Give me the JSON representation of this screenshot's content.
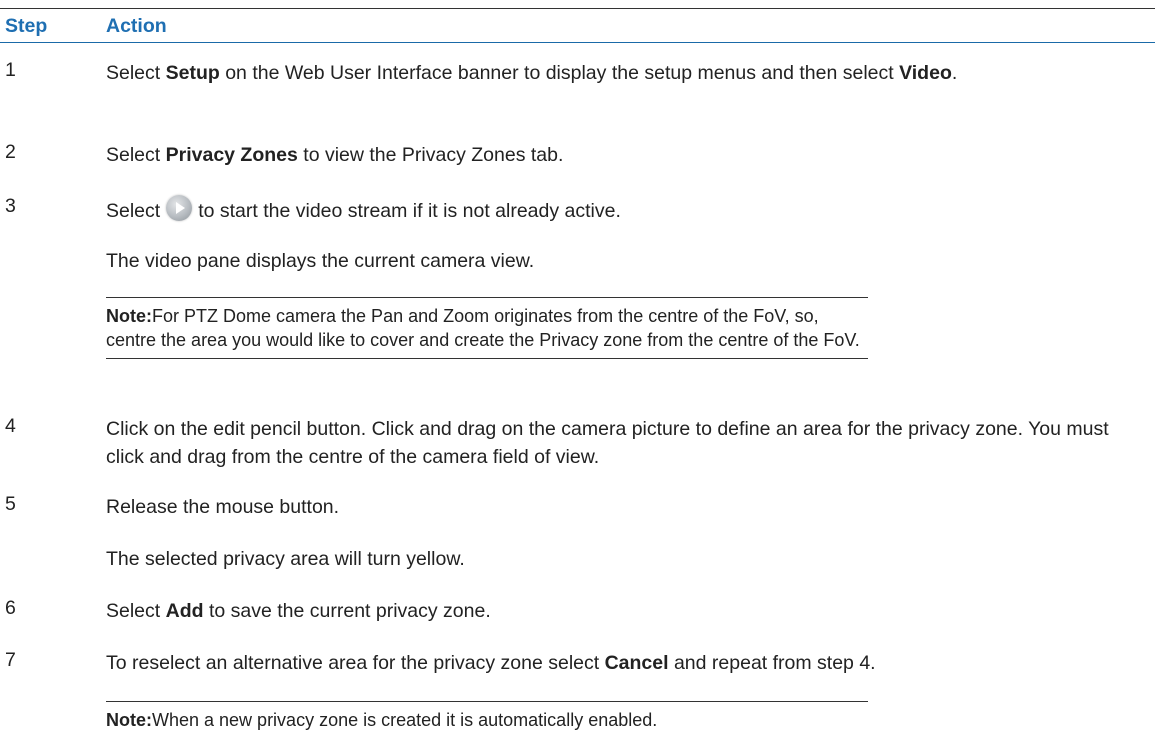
{
  "header": {
    "step": "Step",
    "action": "Action"
  },
  "steps": [
    {
      "number": "1",
      "t1": "Select ",
      "b1": "Setup",
      "t2": " on the Web User Interface banner to display the setup menus and then select ",
      "b2": "Video",
      "t3": "."
    },
    {
      "number": "2",
      "t1": "Select ",
      "b1": "Privacy Zones",
      "t2": " to view the Privacy Zones tab."
    },
    {
      "number": "3",
      "t1": "Select",
      "icon": "play-button-icon",
      "t2": "to start the video stream if it is not already active.",
      "result": "The video pane displays the current camera view.",
      "note_label": "Note:",
      "note_text": "For PTZ Dome camera the Pan and Zoom originates from the centre of the FoV, so, centre the area you would like to cover and create the Privacy zone from the centre of the FoV."
    },
    {
      "number": "4",
      "text": "Click on the edit pencil button. Click and drag on the camera picture to define an area for the privacy zone. You must click and drag from the centre of the camera field of view."
    },
    {
      "number": "5",
      "text": "Release the mouse button.",
      "result": "The selected privacy area will turn yellow."
    },
    {
      "number": "6",
      "t1": "Select ",
      "b1": "Add",
      "t2": " to save the current privacy zone."
    },
    {
      "number": "7",
      "t1": "To reselect an alternative area for the privacy zone select ",
      "b1": "Cancel",
      "t2": " and repeat from step 4.",
      "note_label": "Note:",
      "note_text": "When a new privacy zone is created it is automatically enabled."
    }
  ],
  "colors": {
    "header_text": "#1f6fb2",
    "header_rule": "#1a6aa8",
    "body_text": "#222222"
  }
}
